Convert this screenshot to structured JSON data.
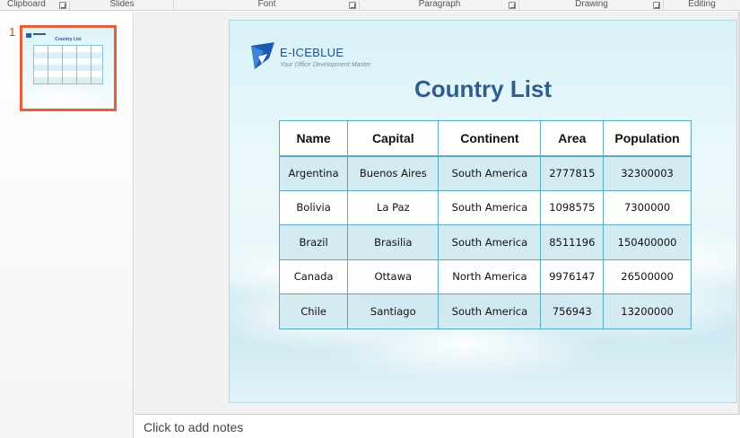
{
  "ribbon": {
    "groups": [
      {
        "label": "Clipboard",
        "launcher": true
      },
      {
        "label": "Slides",
        "launcher": false
      },
      {
        "label": "Font",
        "launcher": true
      },
      {
        "label": "Paragraph",
        "launcher": true
      },
      {
        "label": "Drawing",
        "launcher": true
      },
      {
        "label": "Editing",
        "launcher": false
      }
    ]
  },
  "thumbnails": [
    {
      "number": "1",
      "selected": true
    }
  ],
  "slide": {
    "logo": {
      "brand": "E-ICEBLUE",
      "tagline": "Your Office Development Master"
    },
    "title": "Country List",
    "table": {
      "headers": [
        "Name",
        "Capital",
        "Continent",
        "Area",
        "Population"
      ],
      "rows": [
        [
          "Argentina",
          "Buenos Aires",
          "South America",
          "2777815",
          "32300003"
        ],
        [
          "Bolivia",
          "La Paz",
          "South America",
          "1098575",
          "7300000"
        ],
        [
          "Brazil",
          "Brasilia",
          "South America",
          "8511196",
          "150400000"
        ],
        [
          "Canada",
          "Ottawa",
          "North America",
          "9976147",
          "26500000"
        ],
        [
          "Chile",
          "Santiago",
          "South America",
          "756943",
          "13200000"
        ]
      ]
    }
  },
  "notes": {
    "placeholder": "Click to add notes"
  },
  "colors": {
    "selection_border": "#e5603a",
    "title": "#2f5d92",
    "table_border": "#5aa9bf",
    "band_row": "#cfe9f0"
  }
}
